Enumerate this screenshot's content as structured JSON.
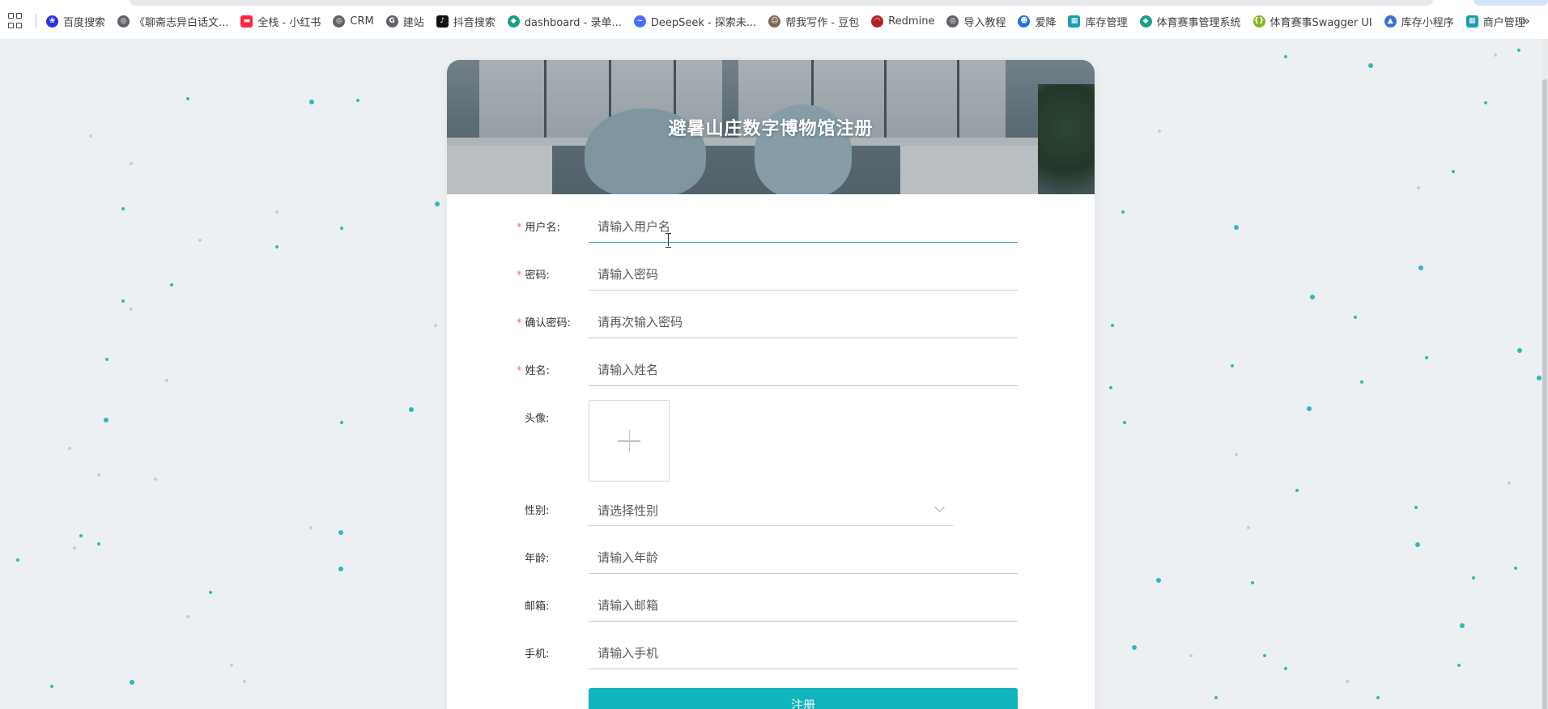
{
  "bookmarks": [
    {
      "label": "百度搜索",
      "icon": "baidu-paw-icon",
      "color": "#2932e1"
    },
    {
      "label": "《聊斋志异白话文...",
      "icon": "globe-icon",
      "color": "#5f6368"
    },
    {
      "label": "全栈 - 小红书",
      "icon": "xiaohongshu-icon",
      "color": "#ff2442"
    },
    {
      "label": "CRM",
      "icon": "globe-icon",
      "color": "#5f6368"
    },
    {
      "label": "建站",
      "icon": "site-builder-icon",
      "color": "#5f6368"
    },
    {
      "label": "抖音搜索",
      "icon": "douyin-icon",
      "color": "#111111"
    },
    {
      "label": "dashboard - 录单...",
      "icon": "leaf-icon",
      "color": "#16a085"
    },
    {
      "label": "DeepSeek - 探索未...",
      "icon": "deepseek-whale-icon",
      "color": "#4d6bfe"
    },
    {
      "label": "帮我写作 - 豆包",
      "icon": "doubao-avatar-icon",
      "color": "#7a6a5c"
    },
    {
      "label": "Redmine",
      "icon": "redmine-icon",
      "color": "#b32024"
    },
    {
      "label": "导入教程",
      "icon": "globe-icon",
      "color": "#5f6368"
    },
    {
      "label": "爱降",
      "icon": "aijiang-icon",
      "color": "#1a73e8"
    },
    {
      "label": "库存管理",
      "icon": "grid-app-icon",
      "color": "#1a9fb0"
    },
    {
      "label": "体育赛事管理系统",
      "icon": "leaf-icon",
      "color": "#16a085"
    },
    {
      "label": "体育赛事Swagger UI",
      "icon": "swagger-icon",
      "color": "#85b623"
    },
    {
      "label": "库存小程序",
      "icon": "mountain-icon",
      "color": "#3a6fd8"
    },
    {
      "label": "商户管理",
      "icon": "grid-app-icon",
      "color": "#1a9fb0"
    }
  ],
  "page": {
    "title": "避暑山庄数字博物馆注册"
  },
  "form": {
    "username": {
      "label": "用户名:",
      "placeholder": "请输入用户名",
      "required": true
    },
    "password": {
      "label": "密码:",
      "placeholder": "请输入密码",
      "required": true
    },
    "confirm_password": {
      "label": "确认密码:",
      "placeholder": "请再次输入密码",
      "required": true
    },
    "name": {
      "label": "姓名:",
      "placeholder": "请输入姓名",
      "required": true
    },
    "avatar": {
      "label": "头像:",
      "required": false
    },
    "gender": {
      "label": "性别:",
      "placeholder": "请选择性别",
      "required": false
    },
    "age": {
      "label": "年龄:",
      "placeholder": "请输入年龄",
      "required": false
    },
    "email": {
      "label": "邮箱:",
      "placeholder": "请输入邮箱",
      "required": false
    },
    "phone": {
      "label": "手机:",
      "placeholder": "请输入手机",
      "required": false
    },
    "required_mark": "*",
    "submit_label": "注册"
  },
  "colors": {
    "accent": "#13b5bd",
    "required": "#f56c6c",
    "page_bg": "#edf0f2",
    "particle": "#31b7b9"
  }
}
